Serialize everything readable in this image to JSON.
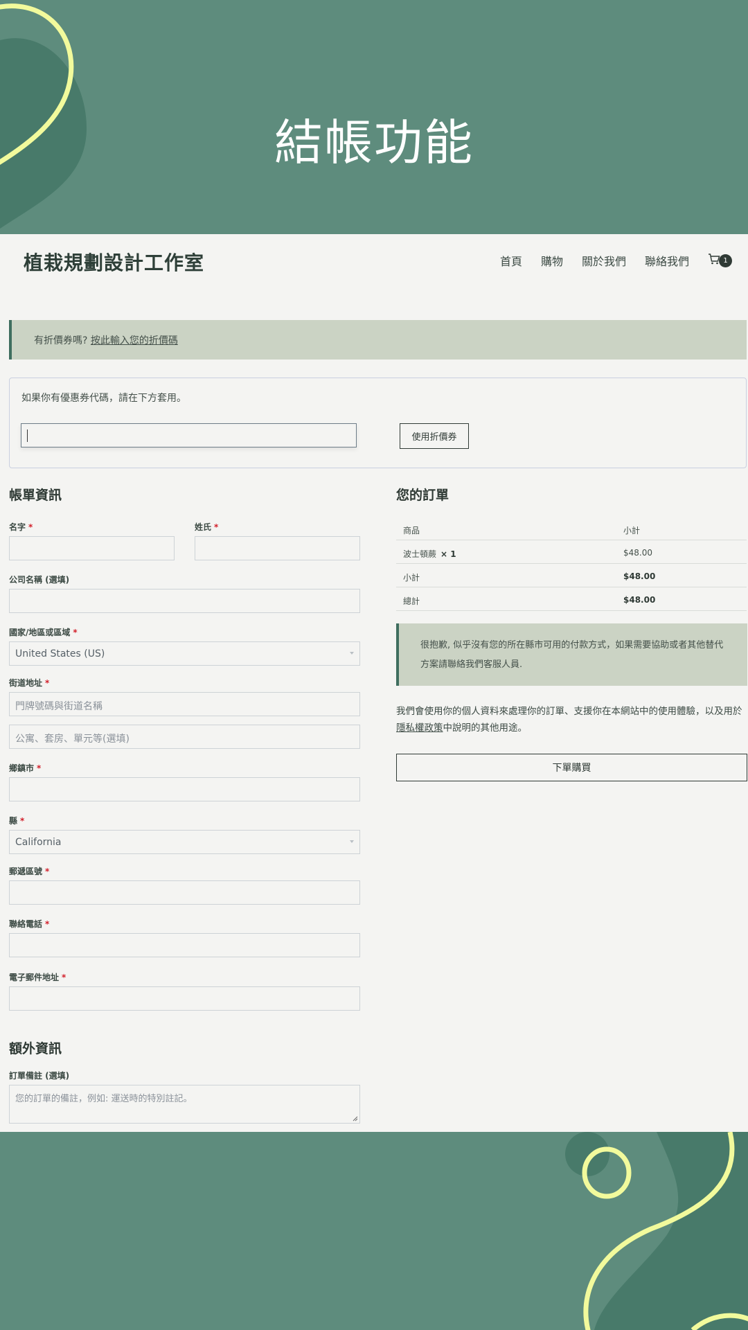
{
  "hero": {
    "title": "結帳功能"
  },
  "header": {
    "site_title": "植栽規劃設計工作室",
    "nav": [
      "首頁",
      "購物",
      "關於我們",
      "聯絡我們"
    ],
    "cart_count": "1"
  },
  "coupon": {
    "notice_prefix": "有折價券嗎?",
    "notice_link": "按此輸入您的折價碼",
    "description": "如果你有優惠券代碼，請在下方套用。",
    "input_value": "",
    "apply_label": "使用折價券"
  },
  "billing": {
    "heading": "帳單資訊",
    "required_mark": "*",
    "first_name_label": "名字",
    "last_name_label": "姓氏",
    "company_label": "公司名稱 (選填)",
    "country_label": "國家/地區或區域",
    "country_value": "United States (US)",
    "street_label": "街道地址",
    "street_placeholder": "門牌號碼與街道名稱",
    "apartment_placeholder": "公寓、套房、單元等(選填)",
    "city_label": "鄉鎮市",
    "state_label": "縣",
    "state_value": "California",
    "postcode_label": "郵遞區號",
    "phone_label": "聯絡電話",
    "email_label": "電子郵件地址"
  },
  "additional": {
    "heading": "額外資訊",
    "notes_label": "訂單備註 (選填)",
    "notes_placeholder": "您的訂單的備註，例如: 運送時的特別註記。"
  },
  "order": {
    "heading": "您的訂單",
    "col_product": "商品",
    "col_subtotal": "小計",
    "item_name": "波士頓蕨",
    "item_qty": "× 1",
    "item_price": "$48.00",
    "subtotal_label": "小計",
    "subtotal_value": "$48.00",
    "total_label": "總計",
    "total_value": "$48.00",
    "payment_notice": "很抱歉, 似乎沒有您的所在縣市可用的付款方式，如果需要協助或者其他替代方案請聯絡我們客服人員.",
    "privacy_before": "我們會使用你的個人資料來處理你的訂單、支援你在本網站中的使用體驗，以及用於",
    "privacy_link": "隱私權政策",
    "privacy_after": "中說明的其他用途。",
    "place_order_label": "下單購買"
  },
  "colors": {
    "hero_bg": "#5e8c7d",
    "deco_dark": "#487a6a",
    "deco_yellow": "#f2fa9c",
    "notice_bg": "#cbd3c4",
    "required": "#d21f2a"
  }
}
